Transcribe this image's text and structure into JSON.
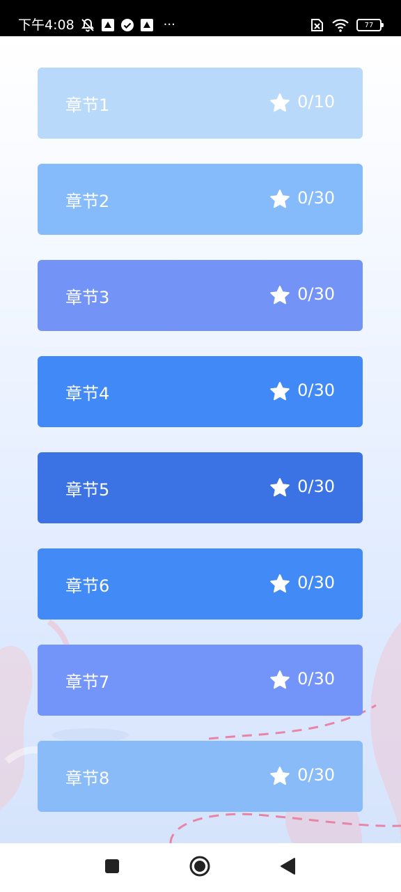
{
  "status_bar": {
    "time": "下午4:08",
    "more": "···",
    "battery": "77",
    "icons": [
      "mute-bell-icon",
      "app-notification-icon",
      "check-circle-icon",
      "app-notification-icon",
      "sim-off-icon",
      "wifi-icon",
      "battery-icon"
    ]
  },
  "chapters": [
    {
      "title": "章节1",
      "score": "0/10",
      "color": "#b9d9fb"
    },
    {
      "title": "章节2",
      "score": "0/30",
      "color": "#86bbfb"
    },
    {
      "title": "章节3",
      "score": "0/30",
      "color": "#7393f7"
    },
    {
      "title": "章节4",
      "score": "0/30",
      "color": "#4189f7"
    },
    {
      "title": "章节5",
      "score": "0/30",
      "color": "#3c73e4"
    },
    {
      "title": "章节6",
      "score": "0/30",
      "color": "#428af6"
    },
    {
      "title": "章节7",
      "score": "0/30",
      "color": "#7395fa"
    },
    {
      "title": "章节8",
      "score": "0/30",
      "color": "#89bbf9"
    }
  ],
  "nav": {
    "icons": [
      "recents-square-icon",
      "home-circle-icon",
      "back-triangle-icon"
    ]
  }
}
